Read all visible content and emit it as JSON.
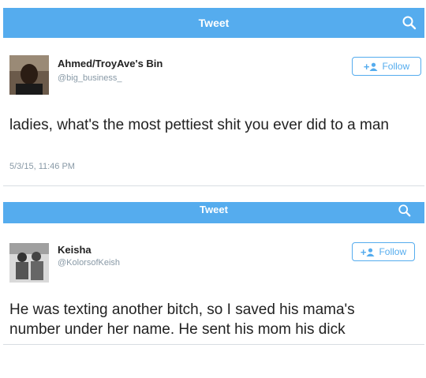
{
  "tweets": [
    {
      "header": {
        "title": "Tweet"
      },
      "author": {
        "name": "Ahmed/TroyAve's Bin",
        "handle": "@big_business_"
      },
      "follow_label": "Follow",
      "text": "ladies, what's the most pettiest shit you ever did to a man",
      "timestamp": "5/3/15, 11:46 PM"
    },
    {
      "header": {
        "title": "Tweet"
      },
      "author": {
        "name": "Keisha",
        "handle": "@KolorsofKeish"
      },
      "follow_label": "Follow",
      "text": "He was texting another bitch, so I saved his mama's number under her name. He sent his mom his dick"
    }
  ],
  "colors": {
    "accent": "#55acee",
    "muted": "#8899a6",
    "text": "#222222"
  },
  "icons": {
    "search": "search-icon",
    "follow": "add-user-icon"
  }
}
